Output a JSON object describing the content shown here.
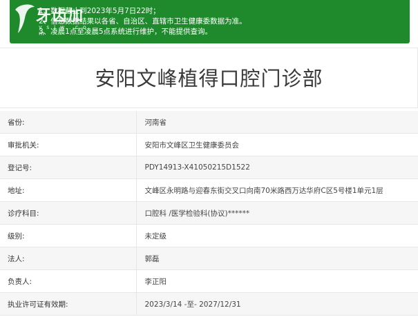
{
  "notice": {
    "lines": [
      "1、数据截止到2023年5月7日22时；",
      "2、信息数据结果以各省、自治区、直辖市卫生健康委数据为准。",
      "3、凌晨1点至凌晨5点系统进行维护，不能提供查询。"
    ]
  },
  "watermark": {
    "wordmark": "牙齿加",
    "sub": "y s j w . c o m"
  },
  "page_title": "安阳文峰植得口腔门诊部",
  "rows": [
    {
      "label": "省份:",
      "value": "河南省"
    },
    {
      "label": "审批机关:",
      "value": "安阳市文峰区卫生健康委员会"
    },
    {
      "label": "登记号:",
      "value": "PDY14913-X41050215D1522"
    },
    {
      "label": "地址:",
      "value": "文峰区永明路与迎春东街交叉口向南70米路西万达华府C区5号楼1单元1层"
    },
    {
      "label": "诊疗科目:",
      "value": "口腔科 /医学检验科(协议)******"
    },
    {
      "label": "级别:",
      "value": "未定级"
    },
    {
      "label": "法人:",
      "value": "郭磊"
    },
    {
      "label": "负责人:",
      "value": "李正阳"
    },
    {
      "label": "执业许可证有效期:",
      "value": "2023/3/14 -至- 2027/12/31"
    }
  ],
  "colors": {
    "notice_bg": "#1e8a2c",
    "row_alt": "#f6f6f6",
    "border": "#e6e6e6"
  }
}
